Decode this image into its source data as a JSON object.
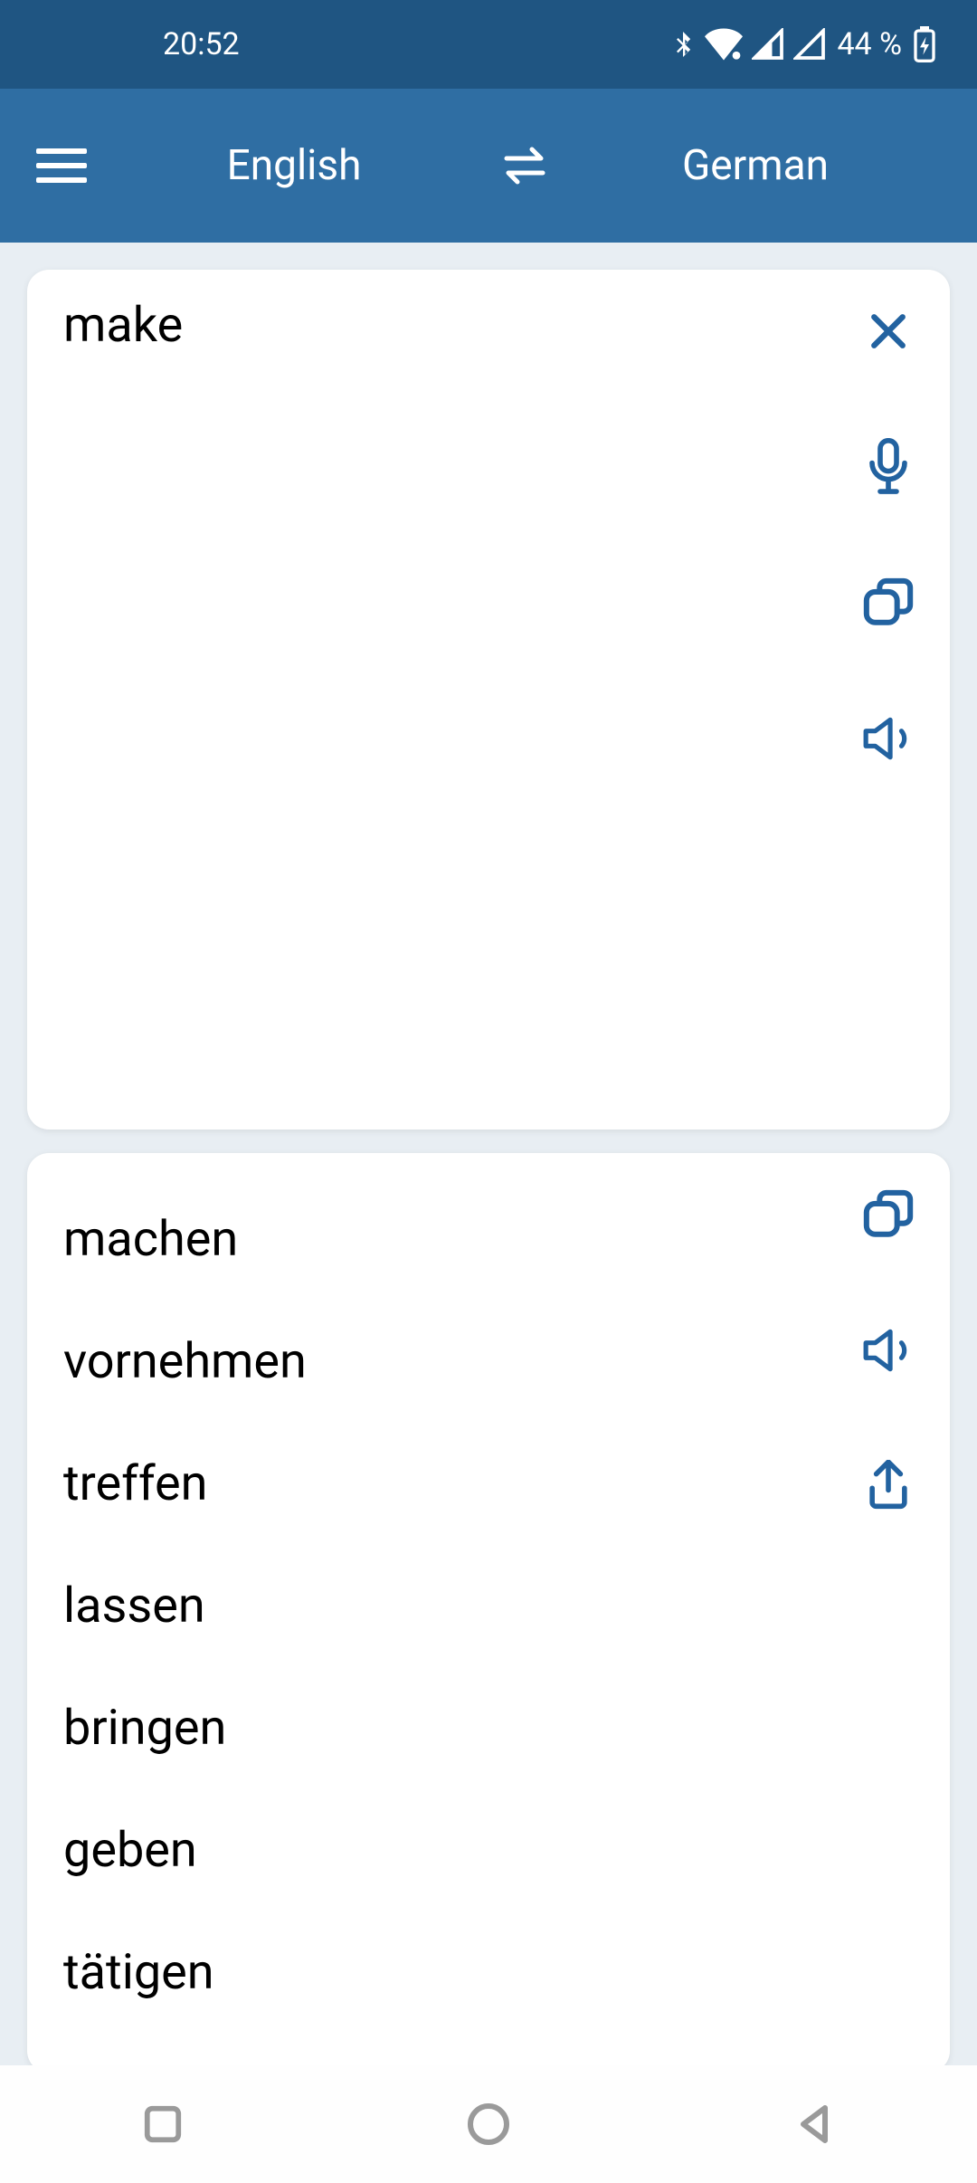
{
  "status_bar": {
    "time": "20:52",
    "battery": "44 %"
  },
  "app_bar": {
    "source_lang": "English",
    "target_lang": "German"
  },
  "input": {
    "text": "make"
  },
  "results": [
    "machen",
    "vornehmen",
    "treffen",
    "lassen",
    "bringen",
    "geben",
    "tätigen"
  ],
  "colors": {
    "accent": "#2262a0",
    "status_bg": "#1f5582",
    "app_bar_bg": "#2f6ea3"
  }
}
